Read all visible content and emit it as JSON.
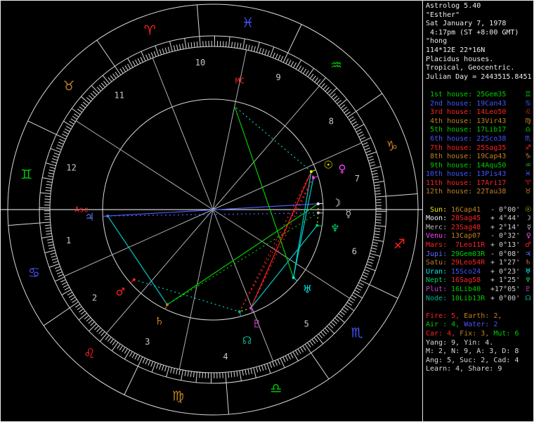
{
  "header": {
    "title": "Astrolog 5.40",
    "name": "\"Esther\"",
    "date": "Sat January 7, 1978",
    "time": " 4:17pm (ST +8:00 GMT)",
    "place": "\"hong",
    "coords": "114*12E 22*16N",
    "house_system": "Placidus houses.",
    "zodiac": "Tropical, Geocentric.",
    "julian": "Julian Day = 2443515.8451"
  },
  "houses": [
    {
      "text": " 1st house: 25Gem35",
      "glyph": "♊",
      "color": "#00cc00",
      "lon": 85.583
    },
    {
      "text": " 2nd house: 19Can43",
      "glyph": "♋",
      "color": "#4455ff",
      "lon": 109.717
    },
    {
      "text": " 3rd house: 14Leo50",
      "glyph": "♌",
      "color": "#ff2222",
      "lon": 134.833
    },
    {
      "text": " 4th house: 13Vir43",
      "glyph": "♍",
      "color": "#c08020",
      "lon": 163.717
    },
    {
      "text": " 5th house: 17Lib17",
      "glyph": "♎",
      "color": "#00cc00",
      "lon": 197.283
    },
    {
      "text": " 6th house: 22Sco38",
      "glyph": "♏",
      "color": "#4455ff",
      "lon": 232.633
    },
    {
      "text": " 7th house: 25Sag35",
      "glyph": "♐",
      "color": "#ff2222",
      "lon": 265.583
    },
    {
      "text": " 8th house: 19Cap43",
      "glyph": "♑",
      "color": "#c08020",
      "lon": 289.717
    },
    {
      "text": " 9th house: 14Aqu50",
      "glyph": "♒",
      "color": "#00cc00",
      "lon": 314.833
    },
    {
      "text": "10th house: 13Pis43",
      "glyph": "♓",
      "color": "#4455ff",
      "lon": 343.717
    },
    {
      "text": "11th house: 17Ari17",
      "glyph": "♈",
      "color": "#ff2222",
      "lon": 17.283
    },
    {
      "text": "12th house: 22Tau38",
      "glyph": "♉",
      "color": "#c08020",
      "lon": 52.633
    }
  ],
  "planets": [
    {
      "id": "Sun",
      "name": " Sun: ",
      "pos": "16Cap41",
      "lat": "- 0°00'",
      "glyph": "☉",
      "color": "#e8e800",
      "sign_color": "#c08020",
      "lon": 286.683,
      "r": 176
    },
    {
      "id": "Moon",
      "name": "Moon: ",
      "pos": "28Sag45",
      "lat": "+ 4°44'",
      "glyph": "☽",
      "color": "#f0f0f0",
      "sign_color": "#ff2222",
      "lon": 268.75,
      "r": 176
    },
    {
      "id": "Merc",
      "name": "Merc: ",
      "pos": "23Sag48",
      "lat": "+ 2°14'",
      "glyph": "☿",
      "color": "#b8b8b8",
      "sign_color": "#ff2222",
      "lon": 263.8,
      "r": 193
    },
    {
      "id": "Venu",
      "name": "Venu: ",
      "pos": "13Cap07",
      "lat": "- 0°32'",
      "glyph": "♀",
      "color": "#ff44ff",
      "sign_color": "#c08020",
      "lon": 283.117,
      "r": 193
    },
    {
      "id": "Mars",
      "name": "Mars: ",
      "pos": " 7Leo11R",
      "lat": "+ 0°13'",
      "glyph": "♂",
      "color": "#ff2222",
      "sign_color": "#ff2222",
      "lon": 127.183,
      "r": 176
    },
    {
      "id": "Jupi",
      "name": "Jupi: ",
      "pos": "29Gem03R",
      "lat": "- 0°08'",
      "glyph": "♃",
      "color": "#6070ff",
      "sign_color": "#00cc00",
      "lon": 89.05,
      "r": 176
    },
    {
      "id": "Satu",
      "name": "Satu: ",
      "pos": "29Leo54R",
      "lat": "+ 1°27'",
      "glyph": "♄",
      "color": "#c08020",
      "sign_color": "#ff2222",
      "lon": 149.9,
      "r": 176
    },
    {
      "id": "Uran",
      "name": "Uran: ",
      "pos": "15Sco24",
      "lat": "+ 0°23'",
      "glyph": "♅",
      "color": "#00e8e8",
      "sign_color": "#4455ff",
      "lon": 225.4,
      "r": 176
    },
    {
      "id": "Nept",
      "name": "Nept: ",
      "pos": "16Sag58",
      "lat": "+ 1°25'",
      "glyph": "♆",
      "color": "#00cc66",
      "sign_color": "#ff2222",
      "lon": 256.967,
      "r": 176
    },
    {
      "id": "Plut",
      "name": "Plut: ",
      "pos": "16Lib40",
      "lat": "+17°05'",
      "glyph": "♇",
      "color": "#cc44cc",
      "sign_color": "#00cc00",
      "lon": 196.667,
      "r": 174
    },
    {
      "id": "Node",
      "name": "Node: ",
      "pos": "10Lib13R",
      "lat": "+ 0°00'",
      "glyph": "☊",
      "color": "#00b090",
      "sign_color": "#00cc00",
      "lon": 190.217,
      "r": 192
    }
  ],
  "wheel": {
    "asc_lon": 85.583,
    "points": [
      {
        "id": "Asc",
        "label": "Asc",
        "lon": 85.583,
        "color": "#ff2222"
      },
      {
        "id": "MC",
        "label": "MC",
        "lon": 343.717,
        "color": "#ff2222"
      }
    ],
    "signs": [
      {
        "glyph": "♈",
        "name": "aries",
        "color": "#ff2222"
      },
      {
        "glyph": "♉",
        "name": "taurus",
        "color": "#c08020"
      },
      {
        "glyph": "♊",
        "name": "gemini",
        "color": "#00cc00"
      },
      {
        "glyph": "♋",
        "name": "cancer",
        "color": "#4455ff"
      },
      {
        "glyph": "♌",
        "name": "leo",
        "color": "#ff2222"
      },
      {
        "glyph": "♍",
        "name": "virgo",
        "color": "#c08020"
      },
      {
        "glyph": "♎",
        "name": "libra",
        "color": "#00cc00"
      },
      {
        "glyph": "♏",
        "name": "scorpio",
        "color": "#4455ff"
      },
      {
        "glyph": "♐",
        "name": "sagittarius",
        "color": "#ff2222"
      },
      {
        "glyph": "♑",
        "name": "capricorn",
        "color": "#c08020"
      },
      {
        "glyph": "♒",
        "name": "aquarius",
        "color": "#00cc00"
      },
      {
        "glyph": "♓",
        "name": "pisces",
        "color": "#4455ff"
      }
    ]
  },
  "aspect_colors": {
    "conjunction": "#e8e800",
    "opposition": "#5060ff",
    "square": "#ff2222",
    "trine": "#00cc00",
    "sextile": "#00cccc"
  },
  "aspects": [
    {
      "p1": "Sun",
      "p2": "Venu",
      "aspect": "conjunction",
      "dotted": true
    },
    {
      "p1": "Sun",
      "p2": "Uran",
      "aspect": "sextile",
      "dotted": false
    },
    {
      "p1": "Sun",
      "p2": "Plut",
      "aspect": "square",
      "dotted": false
    },
    {
      "p1": "Sun",
      "p2": "Node",
      "aspect": "square",
      "dotted": true
    },
    {
      "p1": "Moon",
      "p2": "Merc",
      "aspect": "conjunction",
      "dotted": true
    },
    {
      "p1": "Moon",
      "p2": "Jupi",
      "aspect": "opposition",
      "dotted": false
    },
    {
      "p1": "Moon",
      "p2": "Satu",
      "aspect": "trine",
      "dotted": false
    },
    {
      "p1": "Merc",
      "p2": "Jupi",
      "aspect": "opposition",
      "dotted": true
    },
    {
      "p1": "Merc",
      "p2": "Satu",
      "aspect": "trine",
      "dotted": true
    },
    {
      "p1": "Merc",
      "p2": "Nept",
      "aspect": "conjunction",
      "dotted": true
    },
    {
      "p1": "Venu",
      "p2": "Uran",
      "aspect": "sextile",
      "dotted": false
    },
    {
      "p1": "Venu",
      "p2": "Plut",
      "aspect": "square",
      "dotted": true
    },
    {
      "p1": "Venu",
      "p2": "Node",
      "aspect": "square",
      "dotted": true
    },
    {
      "p1": "Mars",
      "p2": "Node",
      "aspect": "sextile",
      "dotted": true
    },
    {
      "p1": "Jupi",
      "p2": "Satu",
      "aspect": "sextile",
      "dotted": false
    },
    {
      "p1": "Nept",
      "p2": "Plut",
      "aspect": "sextile",
      "dotted": false
    },
    {
      "p1": "Plut",
      "p2": "Node",
      "aspect": "conjunction",
      "dotted": true
    },
    {
      "p1": "Uran",
      "p2": "MC",
      "aspect": "trine",
      "dotted": false
    },
    {
      "p1": "Sun",
      "p2": "MC",
      "aspect": "sextile",
      "dotted": true
    }
  ],
  "stats": [
    {
      "segs": [
        {
          "t": "Fire: 5, ",
          "c": "#ff2222"
        },
        {
          "t": "Earth: 2,",
          "c": "#c08020"
        },
        {
          "t": "",
          "c": "#d8d8d8"
        }
      ]
    },
    {
      "segs": [
        {
          "t": "Air : 4, ",
          "c": "#00cc00"
        },
        {
          "t": "Water: 2",
          "c": "#4455ff"
        },
        {
          "t": "",
          "c": "#d8d8d8"
        }
      ]
    },
    {
      "segs": [
        {
          "t": "Car: 4, ",
          "c": "#ff2222"
        },
        {
          "t": "Fix: 3, ",
          "c": "#c08020"
        },
        {
          "t": "Mut: 6",
          "c": "#00cc00"
        }
      ]
    },
    {
      "segs": [
        {
          "t": "Yang: 9, ",
          "c": "#d8d8d8"
        },
        {
          "t": "Yin: 4.",
          "c": "#d8d8d8"
        },
        {
          "t": "",
          "c": "#d8d8d8"
        }
      ]
    },
    {
      "segs": [
        {
          "t": "M: 2, N: 9, A: 3, D: 8",
          "c": "#d8d8d8"
        },
        {
          "t": "",
          "c": "#d8d8d8"
        },
        {
          "t": "",
          "c": "#d8d8d8"
        }
      ]
    },
    {
      "segs": [
        {
          "t": "Ang: 5, Suc: 2, Cad: 4",
          "c": "#d8d8d8"
        },
        {
          "t": "",
          "c": "#d8d8d8"
        },
        {
          "t": "",
          "c": "#d8d8d8"
        }
      ]
    },
    {
      "segs": [
        {
          "t": "Learn: 4, Share: 9",
          "c": "#d8d8d8"
        },
        {
          "t": "",
          "c": "#d8d8d8"
        },
        {
          "t": "",
          "c": "#d8d8d8"
        }
      ]
    }
  ]
}
